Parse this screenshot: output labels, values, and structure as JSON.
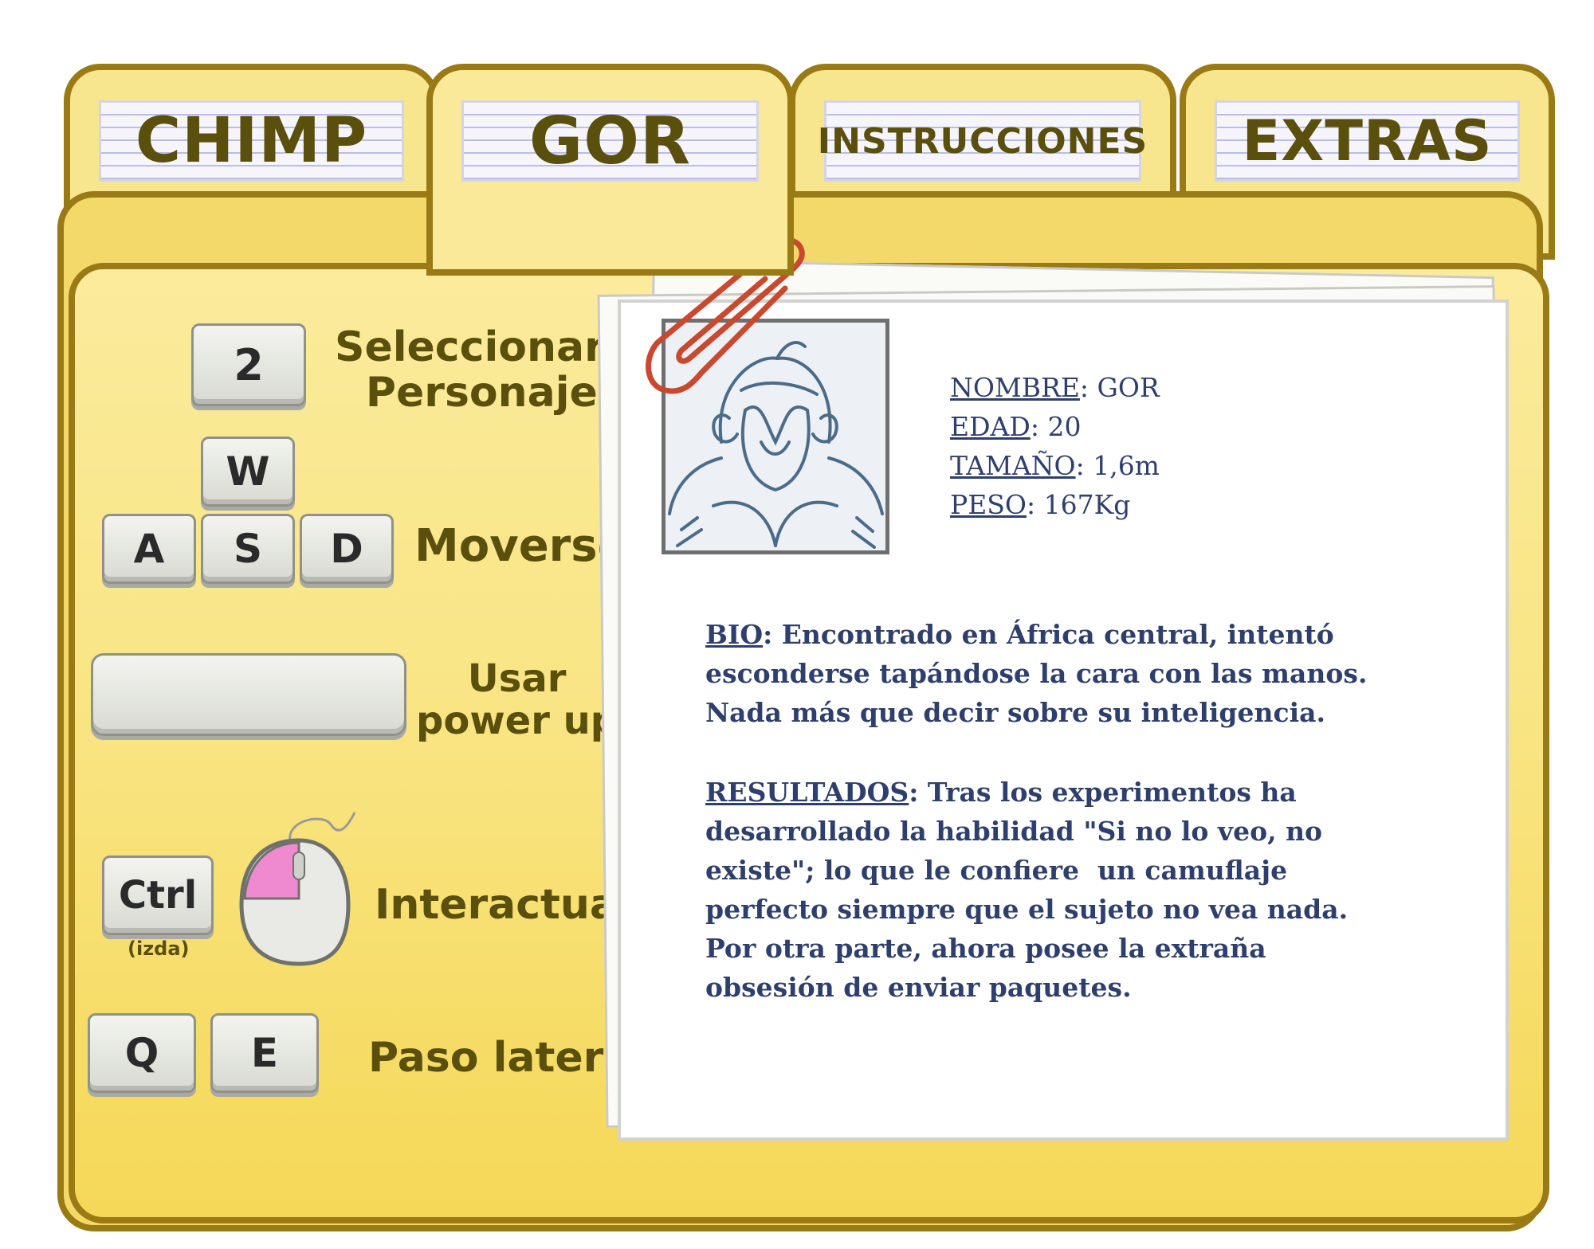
{
  "tabs": [
    {
      "label": "CHIMP",
      "active": false
    },
    {
      "label": "GOR",
      "active": true
    },
    {
      "label": "INSTRUCCIONES",
      "active": false
    },
    {
      "label": "EXTRAS",
      "active": false
    }
  ],
  "controls": {
    "select_character": {
      "key": "2",
      "label_line1": "Seleccionar",
      "label_line2": "Personaje"
    },
    "move": {
      "keys": [
        "W",
        "A",
        "S",
        "D"
      ],
      "label": "Moverse"
    },
    "power_up": {
      "key": "",
      "label_line1": "Usar",
      "label_line2": "power up"
    },
    "interact": {
      "key": "Ctrl",
      "key_note": "(izda)",
      "label": "Interactuar"
    },
    "sidestep": {
      "keys": [
        "Q",
        "E"
      ],
      "label": "Paso lateral"
    }
  },
  "dossier": {
    "fields": [
      {
        "key": "NOMBRE",
        "value": "GOR"
      },
      {
        "key": "EDAD",
        "value": "20"
      },
      {
        "key": "TAMAÑO",
        "value": "1,6m"
      },
      {
        "key": "PESO",
        "value": "167Kg"
      }
    ],
    "bio": {
      "key": "BIO",
      "lines": [
        ": Encontrado en África central, intentó",
        "esconderse tapándose la cara con las manos.",
        "Nada más que decir sobre su inteligencia."
      ]
    },
    "results": {
      "key": "RESULTADOS",
      "lines": [
        ": Tras los experimentos ha",
        "desarrollado la habilidad \"Si no lo veo, no",
        "existe\"; lo que le confiere  un camuflaje",
        "perfecto siempre que el sujeto no vea nada.",
        "Por otra parte, ahora posee la extraña",
        "obsesión de enviar paquetes."
      ]
    }
  },
  "colors": {
    "folder": "#f9e585",
    "folder_border": "#9a7a14",
    "label_text": "#5a4f0c",
    "typed_text": "#2f3f6d",
    "paperclip": "#c9482e",
    "mouse_button": "#f08ad0"
  },
  "icons": [
    "paperclip-icon",
    "mouse-icon",
    "gorilla-portrait"
  ]
}
